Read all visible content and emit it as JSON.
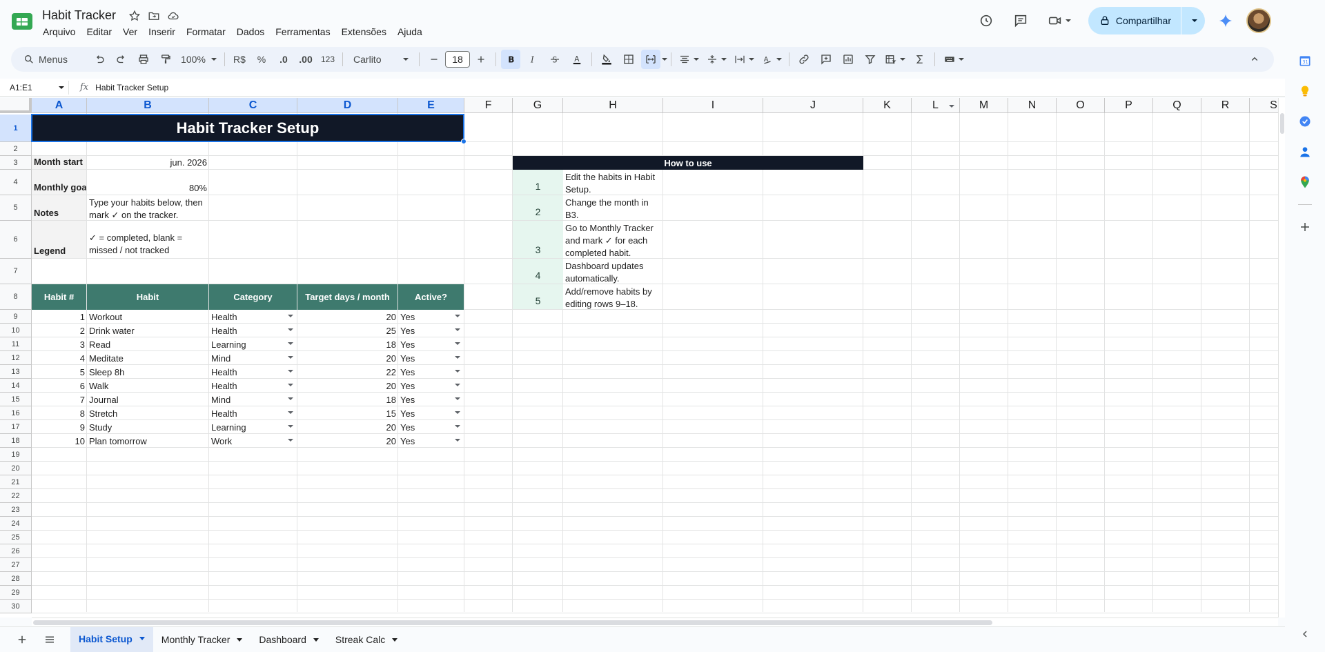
{
  "doc": {
    "title": "Habit Tracker",
    "menu": [
      "Arquivo",
      "Editar",
      "Ver",
      "Inserir",
      "Formatar",
      "Dados",
      "Ferramentas",
      "Extensões",
      "Ajuda"
    ],
    "share_label": "Compartilhar"
  },
  "toolbar": {
    "search_label": "Menus",
    "zoom": "100%",
    "currency": "R$",
    "percent": "%",
    "dec_minus": ".0",
    "dec_plus": ".00",
    "number_format": "123",
    "font": "Carlito",
    "font_size": "18"
  },
  "formula_bar": {
    "name_box": "A1:E1",
    "fx": "fx",
    "value": "Habit Tracker Setup"
  },
  "grid": {
    "columns": [
      "A",
      "B",
      "C",
      "D",
      "E",
      "F",
      "G",
      "H",
      "I",
      "J",
      "K",
      "L",
      "M",
      "N",
      "O",
      "P",
      "Q",
      "R",
      "S"
    ],
    "rows": [
      "1",
      "2",
      "3",
      "4",
      "5",
      "6",
      "7",
      "8",
      "9",
      "10",
      "11",
      "12",
      "13",
      "14",
      "15",
      "16",
      "17",
      "18",
      "19",
      "20",
      "21",
      "22",
      "23",
      "24",
      "25",
      "26",
      "27",
      "28",
      "29",
      "30"
    ],
    "title": "Habit Tracker Setup",
    "month_start_label": "Month start",
    "month_start_value": "jun. 2026",
    "monthly_goal_label": "Monthly goa",
    "monthly_goal_value": "80%",
    "notes_label": "Notes",
    "notes_value": "Type your habits below, then mark ✓ on the tracker.",
    "legend_label": "Legend",
    "legend_value": "✓ = completed, blank = missed / not tracked",
    "table_headers": [
      "Habit #",
      "Habit",
      "Category",
      "Target days / month",
      "Active?"
    ],
    "habits": [
      {
        "n": "1",
        "habit": "Workout",
        "category": "Health",
        "target": "20",
        "active": "Yes"
      },
      {
        "n": "2",
        "habit": "Drink water",
        "category": "Health",
        "target": "25",
        "active": "Yes"
      },
      {
        "n": "3",
        "habit": "Read",
        "category": "Learning",
        "target": "18",
        "active": "Yes"
      },
      {
        "n": "4",
        "habit": "Meditate",
        "category": "Mind",
        "target": "20",
        "active": "Yes"
      },
      {
        "n": "5",
        "habit": "Sleep 8h",
        "category": "Health",
        "target": "22",
        "active": "Yes"
      },
      {
        "n": "6",
        "habit": "Walk",
        "category": "Health",
        "target": "20",
        "active": "Yes"
      },
      {
        "n": "7",
        "habit": "Journal",
        "category": "Mind",
        "target": "18",
        "active": "Yes"
      },
      {
        "n": "8",
        "habit": "Stretch",
        "category": "Health",
        "target": "15",
        "active": "Yes"
      },
      {
        "n": "9",
        "habit": "Study",
        "category": "Learning",
        "target": "20",
        "active": "Yes"
      },
      {
        "n": "10",
        "habit": "Plan tomorrow",
        "category": "Work",
        "target": "20",
        "active": "Yes"
      }
    ],
    "how_to_title": "How to use",
    "how_to_steps": [
      {
        "n": "1",
        "text": "Edit the habits in Habit Setup."
      },
      {
        "n": "2",
        "text": "Change the month in B3."
      },
      {
        "n": "3",
        "text": "Go to Monthly Tracker and mark ✓ for each completed habit."
      },
      {
        "n": "4",
        "text": "Dashboard updates automatically."
      },
      {
        "n": "5",
        "text": "Add/remove habits by editing rows 9–18."
      }
    ]
  },
  "sheet_tabs": [
    "Habit Setup",
    "Monthly Tracker",
    "Dashboard",
    "Streak Calc"
  ],
  "colors": {
    "title_bg": "#111827",
    "header_green": "#3e7a6e",
    "step_bg": "#e6f6ef",
    "accent_blue": "#1a73e8",
    "share_bg": "#c2e7ff"
  }
}
